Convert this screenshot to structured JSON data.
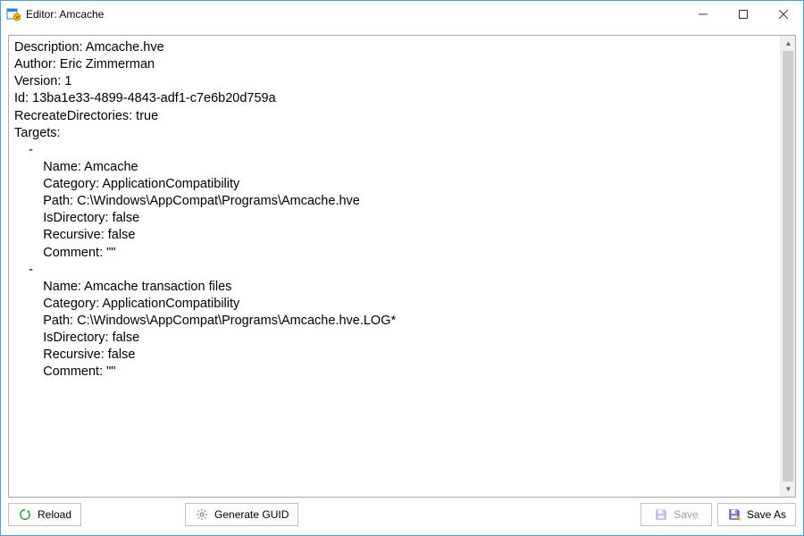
{
  "window": {
    "title": "Editor: Amcache"
  },
  "editor": {
    "content": "Description: Amcache.hve\nAuthor: Eric Zimmerman\nVersion: 1\nId: 13ba1e33-4899-4843-adf1-c7e6b20d759a\nRecreateDirectories: true\nTargets:\n    -\n        Name: Amcache\n        Category: ApplicationCompatibility\n        Path: C:\\Windows\\AppCompat\\Programs\\Amcache.hve\n        IsDirectory: false\n        Recursive: false\n        Comment: \"\"\n    -\n        Name: Amcache transaction files\n        Category: ApplicationCompatibility\n        Path: C:\\Windows\\AppCompat\\Programs\\Amcache.hve.LOG*\n        IsDirectory: false\n        Recursive: false\n        Comment: \"\"\n"
  },
  "buttons": {
    "reload": "Reload",
    "generate_guid": "Generate GUID",
    "save": "Save",
    "save_as": "Save As"
  }
}
